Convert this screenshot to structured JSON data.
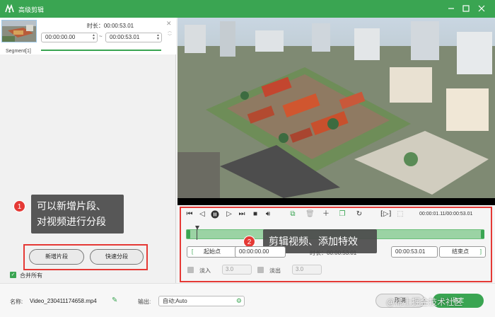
{
  "window": {
    "title": "高级剪辑",
    "logo_icon": "app-logo-icon"
  },
  "segment": {
    "duration_label": "时长：00:00:53.01",
    "start": "00:00:00.00",
    "end": "00:00:53.01",
    "tilde": "~",
    "label": "Segment[1]"
  },
  "annotations": {
    "one_num": "1",
    "one_line1": "可以新增片段、",
    "one_line2": "对视频进行分段",
    "two_num": "2",
    "two_text": "剪辑视频、添加特效"
  },
  "left_buttons": {
    "add_segment": "新增片段",
    "quick_split": "快速分段"
  },
  "merge_all": {
    "label": "合并所有",
    "checked": true
  },
  "player": {
    "time_readout": "00:00:01.11/00:00:53.01"
  },
  "trim": {
    "start_bracket": "[",
    "start_label": "起始点",
    "start_value": "00:00:00.00",
    "duration_label": "时长：00:00:53.01",
    "end_value": "00:00:53.01",
    "end_label": "结束点",
    "end_bracket": "]"
  },
  "fade": {
    "in_label": "淡入",
    "in_value": "3.0",
    "out_label": "淡出",
    "out_value": "3.0"
  },
  "bottom": {
    "name_label": "名称:",
    "file_name": "Video_230411174658.mp4",
    "output_label": "输出:",
    "output_value": "自动;Auto",
    "cancel": "取消",
    "ok": "确定",
    "watermark": "@稀土掘金技术社区"
  },
  "colors": {
    "accent": "#3aa552",
    "annotation_red": "#e53935"
  }
}
